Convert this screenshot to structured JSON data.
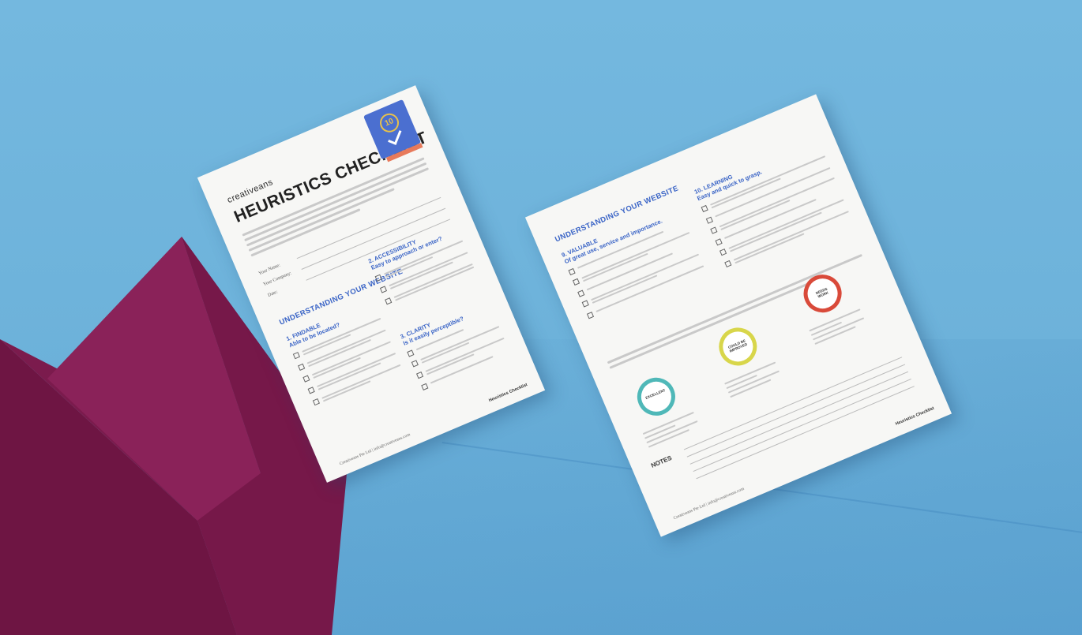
{
  "scene": {
    "colors": {
      "wall": "#74b8df",
      "maroon": "#7a1a4b",
      "accent_blue": "#3a64c6",
      "badge_blue": "#4b6fd0",
      "badge_orange": "#e87a5b"
    }
  },
  "page1": {
    "brand": "creativeans",
    "title": "HEURISTICS CHECKLIST",
    "badge_number": "10",
    "fields": [
      "Your Name:",
      "Your Company:",
      "Date:"
    ],
    "section_title": "UNDERSTANDING YOUR WEBSITE",
    "sections": [
      {
        "heading": "1. FINDABLE",
        "sub": "Able to be located?"
      },
      {
        "heading": "2. ACCESSIBILITY",
        "sub": "Easy to approach or enter?"
      },
      {
        "heading": "3. CLARITY",
        "sub": "Is it easily perceptible?"
      }
    ],
    "footer_left": "Creativeans Pte Ltd | info@creativeans.com",
    "footer_right": "Heuristics Checklist"
  },
  "page2": {
    "section_title": "UNDERSTANDING YOUR WEBSITE",
    "sections": [
      {
        "heading": "9. VALUABLE",
        "sub": "Of great use, service and importance."
      },
      {
        "heading": "10. LEARNING",
        "sub": "Easy and quick to grasp."
      }
    ],
    "rings": [
      {
        "label": "EXCELLENT",
        "color": "#4fb8b8"
      },
      {
        "label": "COULD BE IMPROVED",
        "color": "#d8d64a"
      },
      {
        "label": "NEEDS WORK",
        "color": "#d94a3a"
      }
    ],
    "notes_label": "NOTES",
    "footer_left": "Creativeans Pte Ltd | info@creativeans.com",
    "footer_right": "Heuristics Checklist"
  }
}
